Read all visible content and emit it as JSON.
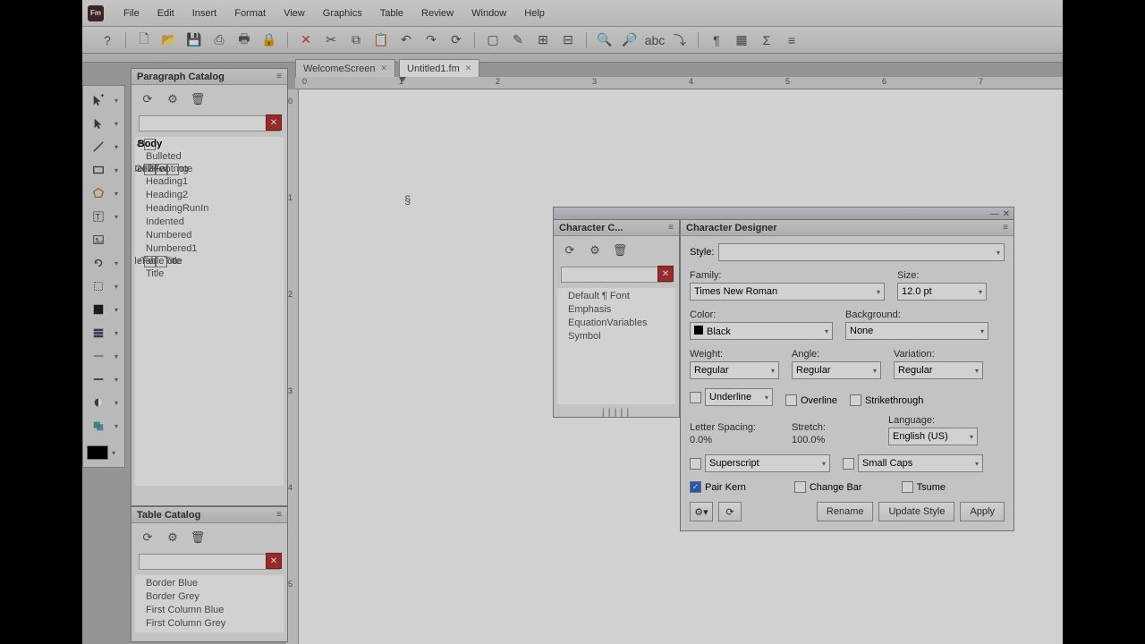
{
  "menus": [
    "File",
    "Edit",
    "Insert",
    "Format",
    "View",
    "Graphics",
    "Table",
    "Review",
    "Window",
    "Help"
  ],
  "app_badge": "Fm",
  "tabs": [
    {
      "label": "WelcomeScreen",
      "active": false
    },
    {
      "label": "Untitled1.fm",
      "active": true
    }
  ],
  "ruler_h": [
    "0",
    "1",
    "2",
    "3",
    "4",
    "5",
    "6",
    "7"
  ],
  "ruler_v": [
    "0",
    "1",
    "2",
    "3",
    "4",
    "5"
  ],
  "paragraph_catalog": {
    "title": "Paragraph Catalog",
    "items": [
      {
        "label": "Body",
        "checked": true,
        "selected": true
      },
      {
        "label": "Bulleted",
        "checked": false
      },
      {
        "label": "CellBody",
        "checked": true
      },
      {
        "label": "CellHeading",
        "checked": true
      },
      {
        "label": "Footnote",
        "checked": true
      },
      {
        "label": "Heading1",
        "checked": false
      },
      {
        "label": "Heading2",
        "checked": false
      },
      {
        "label": "HeadingRunIn",
        "checked": false
      },
      {
        "label": "Indented",
        "checked": false
      },
      {
        "label": "Numbered",
        "checked": false
      },
      {
        "label": "Numbered1",
        "checked": false
      },
      {
        "label": "TableFootnote",
        "checked": true
      },
      {
        "label": "TableTitle",
        "checked": true
      },
      {
        "label": "Title",
        "checked": false
      }
    ]
  },
  "table_catalog": {
    "title": "Table Catalog",
    "items": [
      {
        "label": "Border Blue"
      },
      {
        "label": "Border Grey"
      },
      {
        "label": "First Column Blue"
      },
      {
        "label": "First Column Grey"
      }
    ]
  },
  "char_catalog": {
    "title": "Character C...",
    "items": [
      {
        "label": "Default ¶ Font"
      },
      {
        "label": "Emphasis"
      },
      {
        "label": "EquationVariables"
      },
      {
        "label": "Symbol"
      }
    ]
  },
  "char_designer": {
    "title": "Character Designer",
    "style_label": "Style:",
    "style_value": "",
    "family_label": "Family:",
    "family_value": "Times New Roman",
    "size_label": "Size:",
    "size_value": "12.0 pt",
    "color_label": "Color:",
    "color_value": "Black",
    "background_label": "Background:",
    "background_value": "None",
    "weight_label": "Weight:",
    "weight_value": "Regular",
    "angle_label": "Angle:",
    "angle_value": "Regular",
    "variation_label": "Variation:",
    "variation_value": "Regular",
    "underline_label": "Underline",
    "overline_label": "Overline",
    "strikethrough_label": "Strikethrough",
    "letter_spacing_label": "Letter Spacing:",
    "letter_spacing_value": "0.0%",
    "stretch_label": "Stretch:",
    "stretch_value": "100.0%",
    "language_label": "Language:",
    "language_value": "English (US)",
    "superscript_label": "Superscript",
    "smallcaps_label": "Small Caps",
    "pairkern_label": "Pair Kern",
    "changebar_label": "Change Bar",
    "tsume_label": "Tsume",
    "rename_btn": "Rename",
    "update_btn": "Update Style",
    "apply_btn": "Apply"
  }
}
